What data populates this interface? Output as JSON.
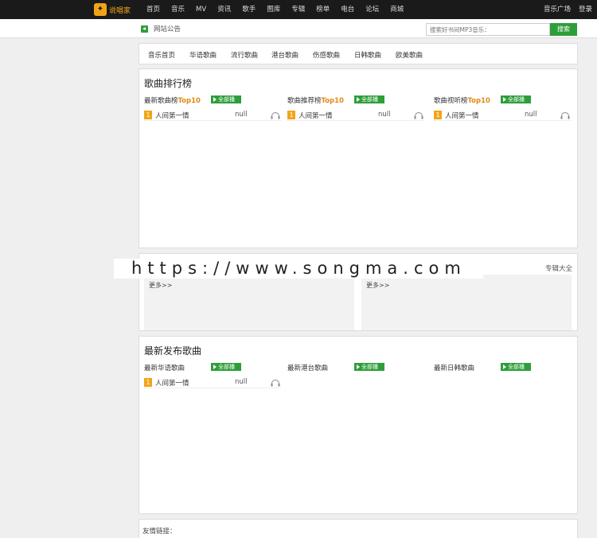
{
  "header": {
    "logo_text": "说唱家",
    "nav": [
      "首页",
      "音乐",
      "MV",
      "资讯",
      "歌手",
      "图库",
      "专辑",
      "榜单",
      "电台",
      "论坛",
      "商城"
    ],
    "right_links": [
      "音乐广场",
      "登录"
    ]
  },
  "notice": {
    "label": "网站公告",
    "search_placeholder": "搜索好书间MP3音乐：",
    "search_button": "搜索"
  },
  "categories": [
    "音乐首页",
    "华语歌曲",
    "流行歌曲",
    "港台歌曲",
    "伤感歌曲",
    "日韩歌曲",
    "欧美歌曲"
  ],
  "rankings": {
    "title": "歌曲排行榜",
    "columns": [
      {
        "title_prefix": "最新歌曲榜",
        "title_hl": "Top10",
        "all_label": "全部播",
        "song": {
          "rank": "1",
          "name": "人间第一情",
          "artist": "null"
        }
      },
      {
        "title_prefix": "歌曲推荐榜",
        "title_hl": "Top10",
        "all_label": "全部播",
        "song": {
          "rank": "1",
          "name": "人间第一情",
          "artist": "null"
        }
      },
      {
        "title_prefix": "歌曲视听榜",
        "title_hl": "Top10",
        "all_label": "全部播",
        "song": {
          "rank": "1",
          "name": "人间第一情",
          "artist": "null"
        }
      }
    ]
  },
  "albums": {
    "link": "专辑大全",
    "more_left": "更多>>",
    "more_right": "更多>>"
  },
  "watermark": "https://www.songma.com",
  "latest": {
    "title": "最新发布歌曲",
    "columns": [
      {
        "title": "最新华语歌曲",
        "all_label": "全部播",
        "song": {
          "rank": "1",
          "name": "人间第一情",
          "artist": "null"
        }
      },
      {
        "title": "最新港台歌曲",
        "all_label": "全部播"
      },
      {
        "title": "最新日韩歌曲",
        "all_label": "全部播"
      }
    ]
  },
  "footer": {
    "links_label": "友情链接："
  },
  "colors": {
    "accent_green": "#2e9e3a",
    "rank_orange": "#f2a418",
    "topbar": "#1a1a1a"
  }
}
